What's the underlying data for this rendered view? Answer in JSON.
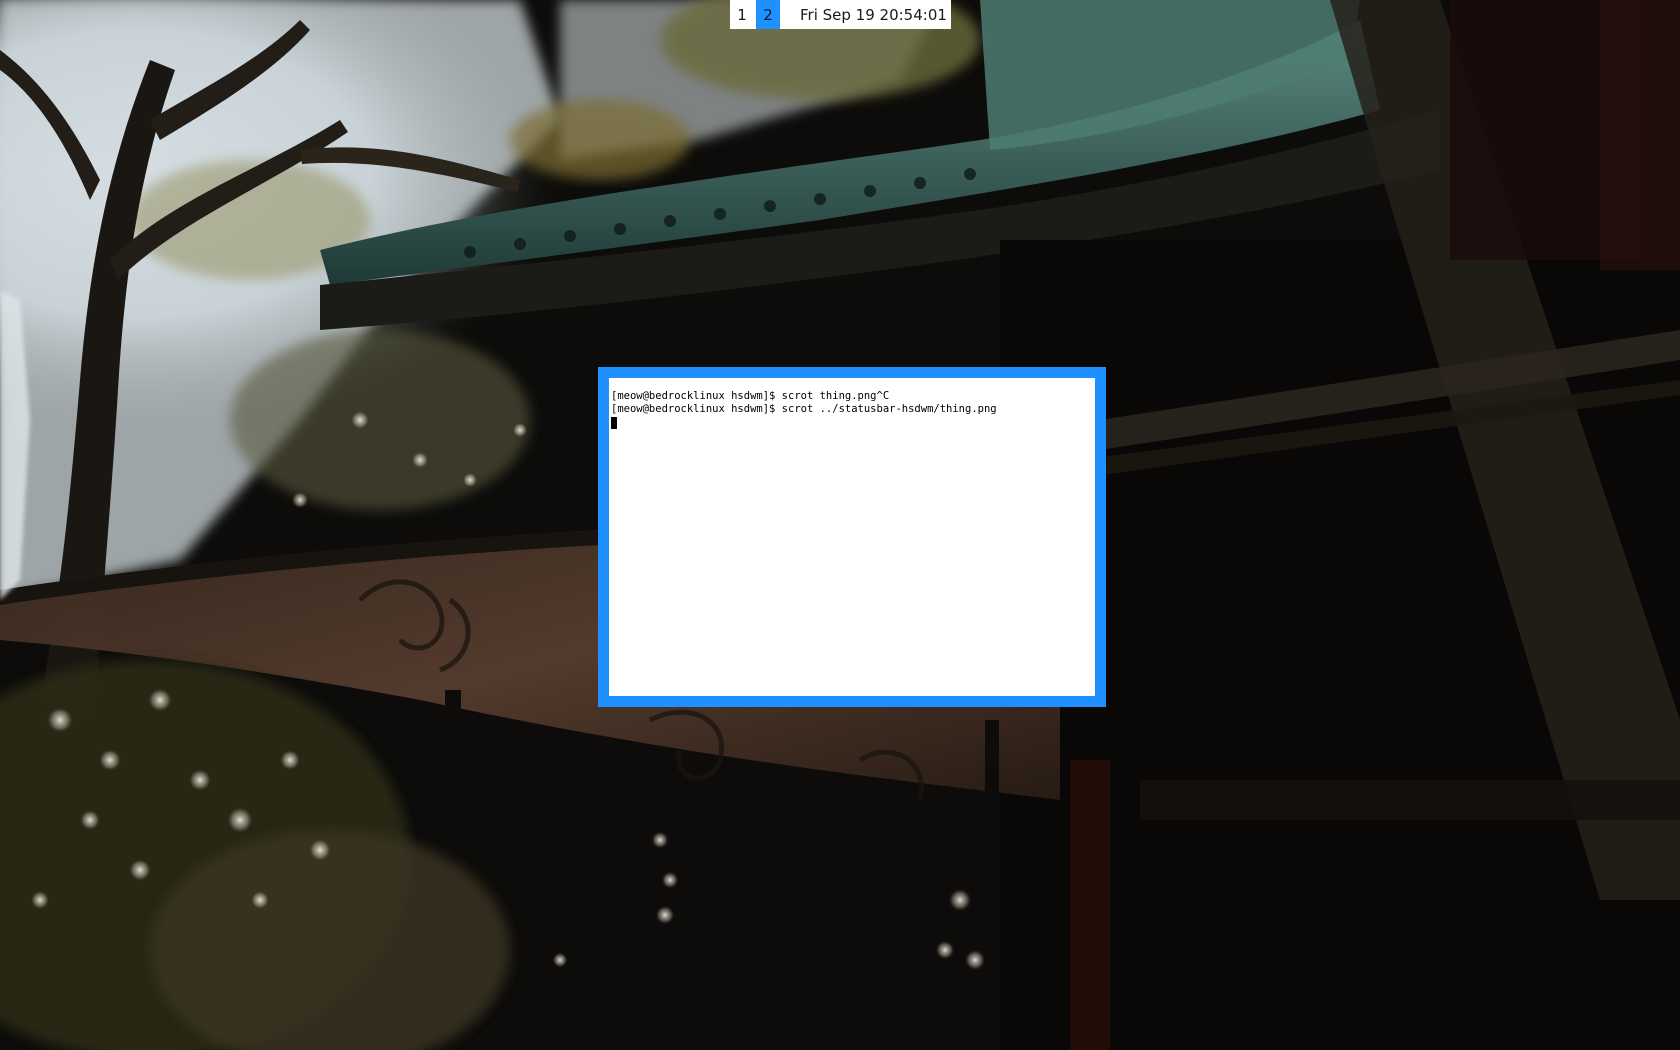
{
  "accent_color": "#1e90ff",
  "statusbar": {
    "tags": [
      {
        "label": "1",
        "active": false
      },
      {
        "label": "2",
        "active": true
      }
    ],
    "clock": "Fri Sep 19 20:54:01"
  },
  "terminal": {
    "lines": [
      "[meow@bedrocklinux hsdwm]$ scrot thing.png^C",
      "[meow@bedrocklinux hsdwm]$ scrot ../statusbar-hsdwm/thing.png"
    ]
  },
  "wallpaper": {
    "icon": "photo-temple-roof-and-trees"
  }
}
